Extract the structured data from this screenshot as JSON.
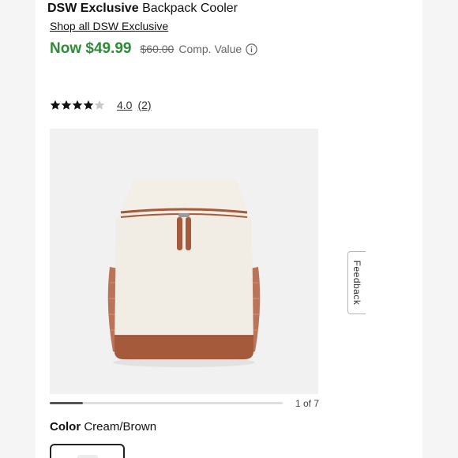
{
  "product": {
    "brand": "DSW Exclusive",
    "name": "Backpack Cooler",
    "shop_all_link": "Shop all DSW Exclusive"
  },
  "pricing": {
    "now_price": "Now $49.99",
    "comp_price": "$60.00",
    "comp_label": "Comp. Value"
  },
  "rating": {
    "stars_filled": 4,
    "stars_total": 5,
    "value": "4.0",
    "review_count": "(2)"
  },
  "carousel": {
    "counter": "1 of 7",
    "progress_fraction": 0.143
  },
  "color": {
    "label": "Color",
    "value": "Cream/Brown"
  },
  "feedback": {
    "label": "Feedback"
  },
  "colors": {
    "price_green": "#2f8a36",
    "cream": "#f1ede4",
    "brown": "#a65a3c"
  },
  "icons": {
    "info": "info-circle-icon",
    "star": "star-icon"
  }
}
